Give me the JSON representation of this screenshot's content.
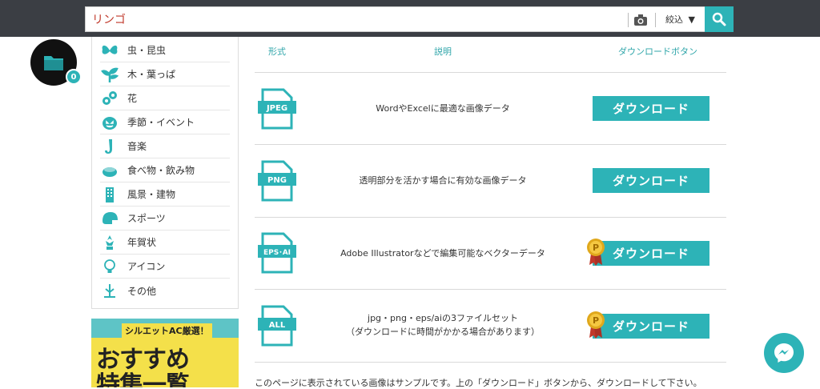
{
  "search": {
    "value": "リンゴ",
    "filter_label": "絞込",
    "filter_arrow": "▼"
  },
  "folder": {
    "count": "0"
  },
  "sidebar": {
    "items": [
      {
        "label": "虫・昆虫",
        "icon": "butterfly-icon"
      },
      {
        "label": "木・葉っぱ",
        "icon": "leaf-icon"
      },
      {
        "label": "花",
        "icon": "flower-icon"
      },
      {
        "label": "季節・イベント",
        "icon": "pumpkin-icon"
      },
      {
        "label": "音楽",
        "icon": "saxophone-icon"
      },
      {
        "label": "食べ物・飲み物",
        "icon": "food-icon"
      },
      {
        "label": "風景・建物",
        "icon": "building-icon"
      },
      {
        "label": "スポーツ",
        "icon": "helmet-icon"
      },
      {
        "label": "年賀状",
        "icon": "new-year-icon"
      },
      {
        "label": "アイコン",
        "icon": "bulb-icon"
      },
      {
        "label": "その他",
        "icon": "misc-icon"
      }
    ]
  },
  "banner": {
    "sub": "シルエットAC厳選！",
    "line1": "おすすめ",
    "line2": "特集一覧"
  },
  "table": {
    "headers": {
      "format": "形式",
      "description": "説明",
      "download": "ダウンロードボタン"
    },
    "rows": [
      {
        "format": "JPEG",
        "desc1": "WordやExcelに最適な画像データ",
        "desc2": "",
        "button": "ダウンロード",
        "premium": false
      },
      {
        "format": "PNG",
        "desc1": "透明部分を活かす場合に有効な画像データ",
        "desc2": "",
        "button": "ダウンロード",
        "premium": false
      },
      {
        "format": "EPS･AI",
        "desc1": "Adobe Illustratorなどで編集可能なベクターデータ",
        "desc2": "",
        "button": "ダウンロード",
        "premium": true
      },
      {
        "format": "ALL",
        "desc1": "jpg・png・eps/aiの3ファイルセット",
        "desc2": "（ダウンロードに時間がかかる場合があります）",
        "button": "ダウンロード",
        "premium": true
      }
    ]
  },
  "notice": "このページに表示されている画像はサンプルです。上の「ダウンロード」ボタンから、ダウンロードして下さい。",
  "colors": {
    "accent": "#2db3b7",
    "topbar": "#3b3e44",
    "header_text": "#2ea5a9",
    "medal": "#e0a81c"
  }
}
